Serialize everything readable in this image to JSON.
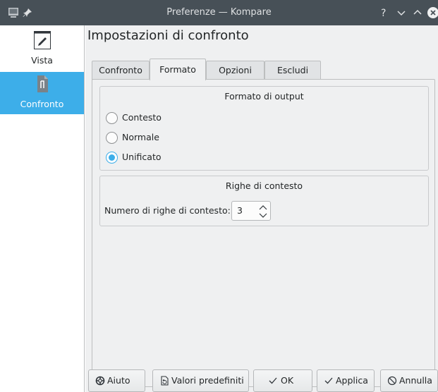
{
  "window": {
    "title": "Preferenze — Kompare",
    "help_glyph": "?"
  },
  "sidebar": {
    "items": [
      {
        "label": "Vista",
        "icon": "brush-icon"
      },
      {
        "label": "Confronto",
        "icon": "diff-file-icon",
        "selected": true
      }
    ]
  },
  "main": {
    "title": "Impostazioni di confronto",
    "tabs": [
      {
        "label": "Confronto"
      },
      {
        "label": "Formato",
        "active": true
      },
      {
        "label": "Opzioni"
      },
      {
        "label": "Escludi"
      }
    ],
    "output_group": {
      "title": "Formato di output",
      "options": [
        {
          "label": "Contesto",
          "checked": false
        },
        {
          "label": "Normale",
          "checked": false
        },
        {
          "label": "Unificato",
          "checked": true
        }
      ]
    },
    "context_group": {
      "title": "Righe di contesto",
      "field_label": "Numero di righe di contesto:",
      "value": "3"
    }
  },
  "buttons": {
    "help": "Aiuto",
    "defaults": "Valori predefiniti",
    "ok": "OK",
    "apply": "Applica",
    "cancel": "Annulla"
  },
  "colors": {
    "accent": "#3daee9",
    "titlebar": "#475057",
    "window_bg": "#eff0f1"
  }
}
